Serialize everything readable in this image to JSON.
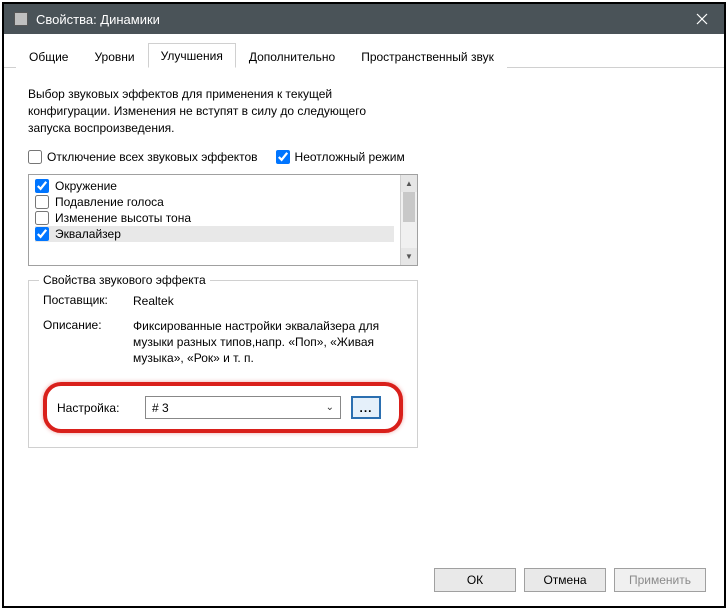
{
  "title": "Свойства: Динамики",
  "tabs": [
    "Общие",
    "Уровни",
    "Улучшения",
    "Дополнительно",
    "Пространственный звук"
  ],
  "active_tab": 2,
  "description": "Выбор звуковых эффектов для применения к текущей конфигурации. Изменения не вступят в силу до следующего запуска воспроизведения.",
  "checks": {
    "disable_all": "Отключение всех звуковых эффектов",
    "immediate": "Неотложный режим"
  },
  "effects": [
    {
      "label": "Окружение",
      "checked": true
    },
    {
      "label": "Подавление голоса",
      "checked": false
    },
    {
      "label": "Изменение высоты тона",
      "checked": false
    },
    {
      "label": "Эквалайзер",
      "checked": true,
      "selected": true
    }
  ],
  "group": {
    "title": "Свойства звукового эффекта",
    "provider_label": "Поставщик:",
    "provider_value": "Realtek",
    "desc_label": "Описание:",
    "desc_value": "Фиксированные настройки эквалайзера для музыки разных типов,напр. «Поп», «Живая музыка», «Рок» и т. п."
  },
  "setting": {
    "label": "Настройка:",
    "value": "# 3",
    "ellipsis": "..."
  },
  "buttons": {
    "ok": "ОК",
    "cancel": "Отмена",
    "apply": "Применить"
  }
}
